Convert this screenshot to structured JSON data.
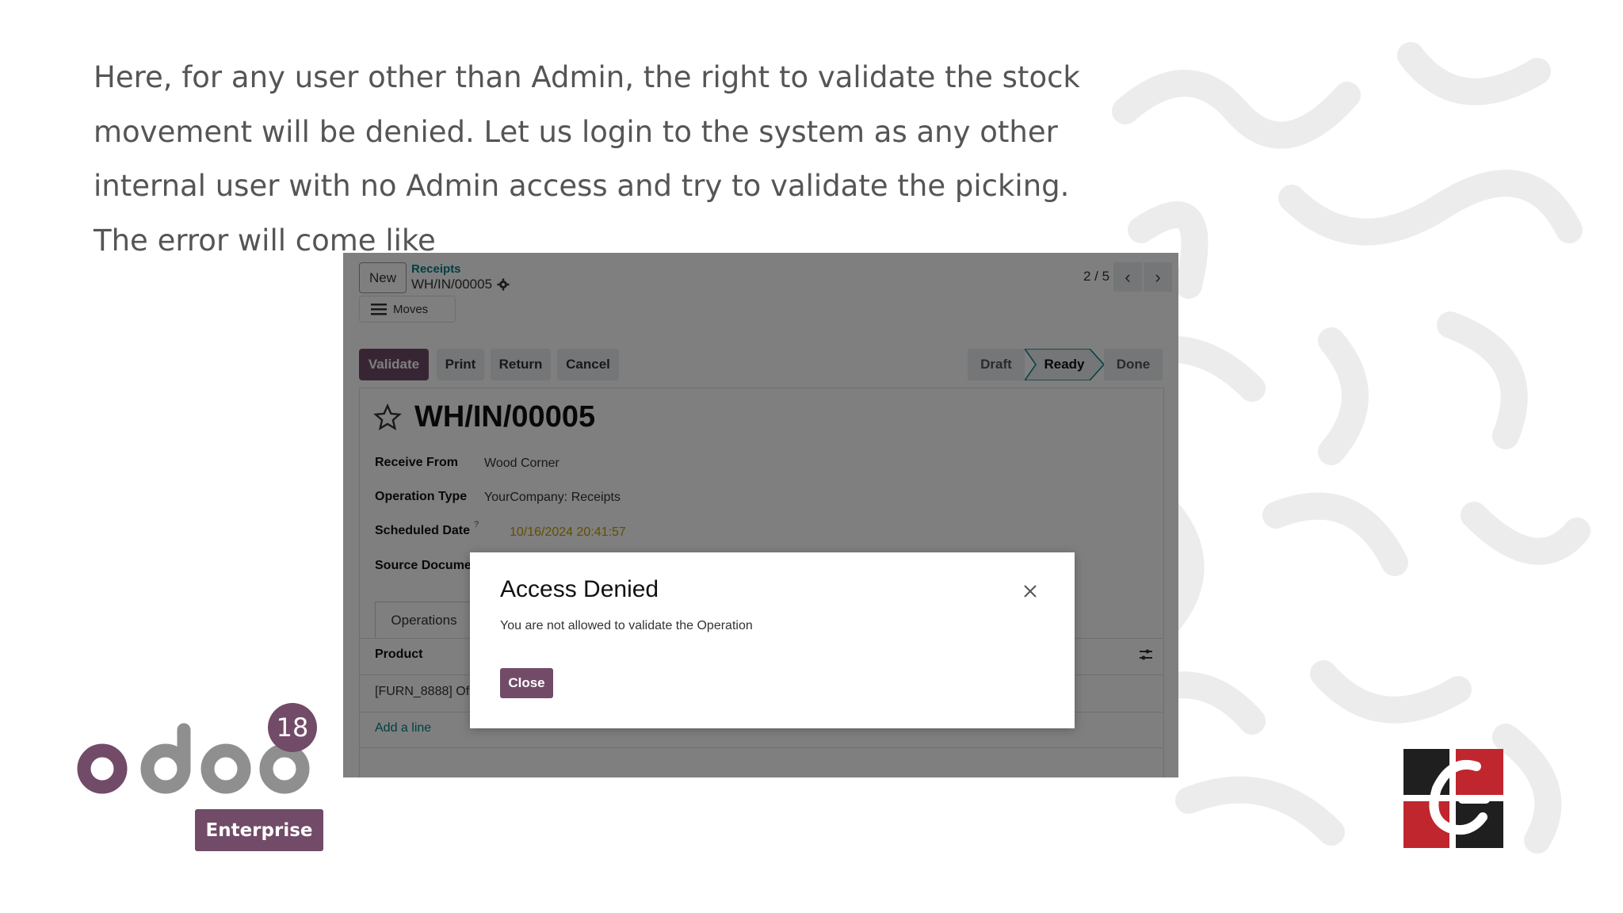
{
  "slide": {
    "text": "Here, for any user other than Admin, the right to validate the stock movement will be denied. Let us login to the system as any other internal user with no Admin access and try to validate the picking. The error will come like"
  },
  "control_panel": {
    "new_button": "New",
    "breadcrumb_parent": "Receipts",
    "breadcrumb_current": "WH/IN/00005",
    "moves_button": "Moves",
    "pager": "2 / 5"
  },
  "action_bar": {
    "validate": "Validate",
    "print": "Print",
    "return": "Return",
    "cancel": "Cancel",
    "statuses": [
      "Draft",
      "Ready",
      "Done"
    ],
    "active_status": "Ready"
  },
  "record": {
    "title": "WH/IN/00005",
    "fields": {
      "receive_from_label": "Receive From",
      "receive_from_value": "Wood Corner",
      "operation_type_label": "Operation Type",
      "operation_type_value": "YourCompany: Receipts",
      "scheduled_date_label": "Scheduled Date",
      "scheduled_date_value": "10/16/2024 20:41:57",
      "source_document_label": "Source Docume"
    },
    "tab_operations": "Operations",
    "product_header": "Product",
    "product_row": "[FURN_8888] Of",
    "add_line": "Add a line"
  },
  "dialog": {
    "title": "Access Denied",
    "message": "You are not allowed to validate the Operation",
    "close_button": "Close"
  },
  "branding": {
    "version": "18",
    "edition": "Enterprise"
  },
  "colors": {
    "odoo_purple": "#714b67",
    "teal_link": "#017e84",
    "warning_date": "#c49a00"
  }
}
